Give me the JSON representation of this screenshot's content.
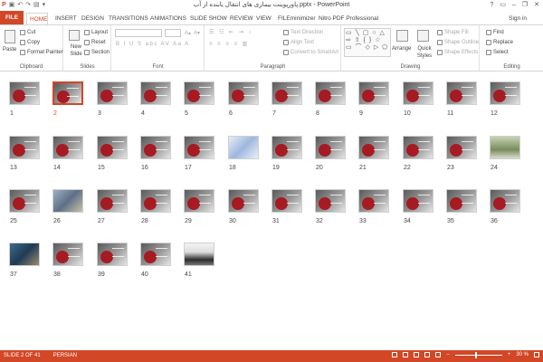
{
  "window": {
    "title": "پاورپوینت بیماری های انتقال یابنده از آب.pptx - PowerPoint",
    "help": "?",
    "minimize": "–",
    "restore": "❐",
    "close": "✕",
    "signin": "Sign in"
  },
  "tabs": [
    {
      "label": "FILE"
    },
    {
      "label": "HOME"
    },
    {
      "label": "INSERT"
    },
    {
      "label": "DESIGN"
    },
    {
      "label": "TRANSITIONS"
    },
    {
      "label": "ANIMATIONS"
    },
    {
      "label": "SLIDE SHOW"
    },
    {
      "label": "REVIEW"
    },
    {
      "label": "VIEW"
    },
    {
      "label": "FILEminimizer"
    },
    {
      "label": "Nitro PDF Professional"
    }
  ],
  "ribbon": {
    "clipboard": {
      "label": "Clipboard",
      "paste": "Paste",
      "cut": "Cut",
      "copy": "Copy",
      "format_painter": "Format Painter"
    },
    "slides": {
      "label": "Slides",
      "new_slide": "New Slide",
      "layout": "Layout",
      "reset": "Reset",
      "section": "Section"
    },
    "font": {
      "label": "Font",
      "row2": "B I U S abc AV Aa A"
    },
    "paragraph": {
      "label": "Paragraph",
      "text_direction": "Text Direction",
      "align_text": "Align Text",
      "convert_smartart": "Convert to SmartArt"
    },
    "drawing": {
      "label": "Drawing",
      "shapes": "▭ ╲ ▢ ○ △ ⇨ ⇧ { } ☆ ▭ ⌒ ◇ ▷ ⬠",
      "arrange": "Arrange",
      "quick_styles": "Quick Styles",
      "shape_fill": "Shape Fill",
      "shape_outline": "Shape Outline",
      "shape_effects": "Shape Effects"
    },
    "editing": {
      "label": "Editing",
      "find": "Find",
      "replace": "Replace",
      "select": "Select"
    }
  },
  "slides": [
    {
      "num": "1",
      "style": "dark"
    },
    {
      "num": "2",
      "style": "dark"
    },
    {
      "num": "3",
      "style": "dark"
    },
    {
      "num": "4",
      "style": "dark"
    },
    {
      "num": "5",
      "style": "dark"
    },
    {
      "num": "6",
      "style": "dark"
    },
    {
      "num": "7",
      "style": "dark"
    },
    {
      "num": "8",
      "style": "dark"
    },
    {
      "num": "9",
      "style": "dark"
    },
    {
      "num": "10",
      "style": "dark"
    },
    {
      "num": "11",
      "style": "dark"
    },
    {
      "num": "12",
      "style": "dark"
    },
    {
      "num": "13",
      "style": "dark"
    },
    {
      "num": "14",
      "style": "dark"
    },
    {
      "num": "15",
      "style": "dark"
    },
    {
      "num": "16",
      "style": "dark"
    },
    {
      "num": "17",
      "style": "dark"
    },
    {
      "num": "18",
      "style": "blue"
    },
    {
      "num": "19",
      "style": "dark"
    },
    {
      "num": "20",
      "style": "dark"
    },
    {
      "num": "21",
      "style": "dark"
    },
    {
      "num": "22",
      "style": "dark"
    },
    {
      "num": "23",
      "style": "dark"
    },
    {
      "num": "24",
      "style": "photo1"
    },
    {
      "num": "25",
      "style": "dark"
    },
    {
      "num": "26",
      "style": "photo2"
    },
    {
      "num": "27",
      "style": "dark"
    },
    {
      "num": "28",
      "style": "dark"
    },
    {
      "num": "29",
      "style": "dark"
    },
    {
      "num": "30",
      "style": "dark"
    },
    {
      "num": "31",
      "style": "dark"
    },
    {
      "num": "32",
      "style": "dark"
    },
    {
      "num": "33",
      "style": "dark"
    },
    {
      "num": "34",
      "style": "dark"
    },
    {
      "num": "35",
      "style": "dark"
    },
    {
      "num": "36",
      "style": "dark"
    },
    {
      "num": "37",
      "style": "photo3"
    },
    {
      "num": "38",
      "style": "dark"
    },
    {
      "num": "39",
      "style": "dark"
    },
    {
      "num": "40",
      "style": "dark"
    },
    {
      "num": "41",
      "style": "photo4"
    }
  ],
  "selected_slide": "2",
  "status": {
    "slide_info": "SLIDE 2 OF 41",
    "language": "PERSIAN",
    "zoom": "30 %",
    "zoom_minus": "–",
    "zoom_plus": "+"
  },
  "colors": {
    "accent": "#d24726"
  }
}
